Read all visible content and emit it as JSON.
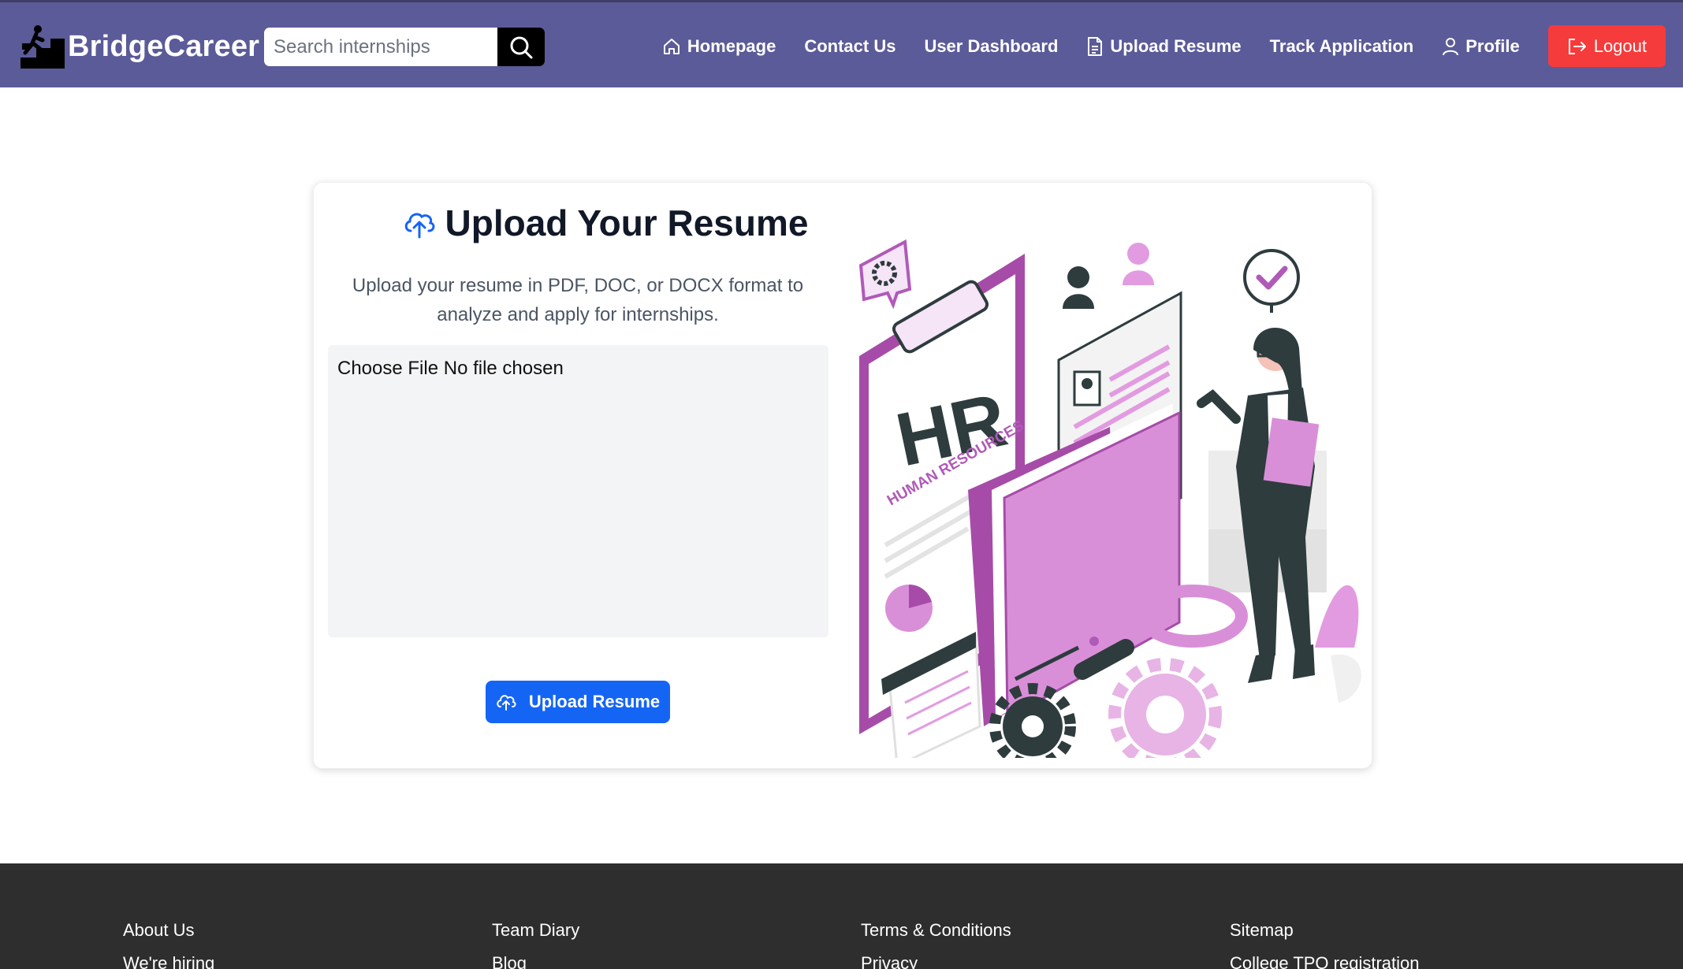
{
  "header": {
    "brand": "BridgeCareer",
    "search_placeholder": "Search internships",
    "nav": {
      "homepage": "Homepage",
      "contact": "Contact Us",
      "dashboard": "User Dashboard",
      "upload": "Upload Resume",
      "track": "Track Application",
      "profile": "Profile",
      "logout": "Logout"
    }
  },
  "upload_card": {
    "title": "Upload Your Resume",
    "description": "Upload your resume in PDF, DOC, or DOCX format to analyze and apply for internships.",
    "file_input_text": "Choose File No file chosen",
    "button_label": "Upload Resume",
    "illustration": {
      "clipboard_heading": "HR",
      "clipboard_subheading": "HUMAN RESOURCES"
    }
  },
  "footer": {
    "col1": [
      "About Us",
      "We're hiring"
    ],
    "col2": [
      "Team Diary",
      "Blog"
    ],
    "col3": [
      "Terms & Conditions",
      "Privacy"
    ],
    "col4": [
      "Sitemap",
      "College TPO registration"
    ]
  },
  "colors": {
    "navbar": "#5b5b99",
    "logout": "#f53b3b",
    "primary_button": "#1565f5",
    "footer": "#2e2e2e",
    "accent_purple": "#b05ab8"
  }
}
